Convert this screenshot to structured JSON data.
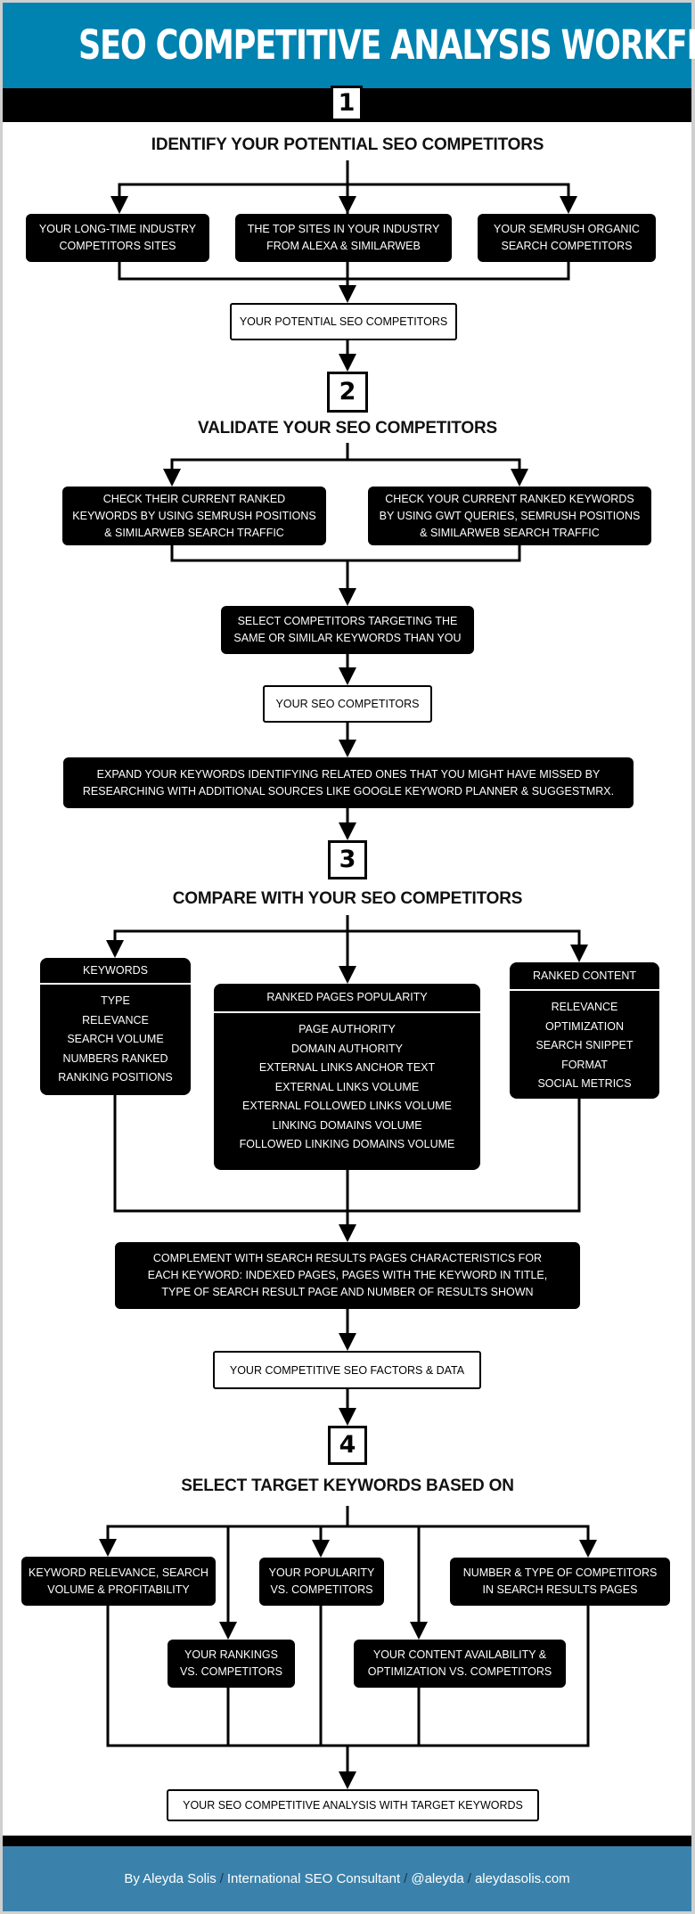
{
  "title": "SEO COMPETITIVE ANALYSIS WORKFLOW",
  "colors": {
    "header_blue": "#0083b0",
    "footer_blue": "#3a82ab",
    "box_black": "#000000",
    "frame_gray": "#cfcfcf"
  },
  "steps": [
    {
      "number": "1",
      "heading": "IDENTIFY YOUR POTENTIAL SEO COMPETITORS",
      "sources": [
        [
          "YOUR LONG-TIME INDUSTRY",
          "COMPETITORS SITES"
        ],
        [
          "THE TOP SITES IN YOUR INDUSTRY",
          "FROM ALEXA & SIMILARWEB"
        ],
        [
          "YOUR SEMRUSH ORGANIC",
          "SEARCH COMPETITORS"
        ]
      ],
      "result": "YOUR POTENTIAL SEO COMPETITORS"
    },
    {
      "number": "2",
      "heading": "VALIDATE YOUR SEO COMPETITORS",
      "checks": [
        [
          "CHECK THEIR CURRENT RANKED",
          "KEYWORDS BY USING SEMRUSH POSITIONS",
          "& SIMILARWEB SEARCH TRAFFIC"
        ],
        [
          "CHECK YOUR CURRENT RANKED KEYWORDS",
          "BY USING GWT QUERIES, SEMRUSH POSITIONS",
          "& SIMILARWEB SEARCH TRAFFIC"
        ]
      ],
      "select": [
        "SELECT COMPETITORS TARGETING THE",
        "SAME OR SIMILAR KEYWORDS THAN YOU"
      ],
      "result": "YOUR SEO COMPETITORS",
      "expand": [
        "EXPAND YOUR KEYWORDS IDENTIFYING RELATED ONES THAT YOU MIGHT HAVE MISSED BY",
        "RESEARCHING WITH ADDITIONAL SOURCES LIKE GOOGLE KEYWORD PLANNER & SUGGESTMRX."
      ]
    },
    {
      "number": "3",
      "heading": "COMPARE WITH YOUR SEO COMPETITORS",
      "cards": [
        {
          "title": "KEYWORDS",
          "items": [
            "TYPE",
            "RELEVANCE",
            "SEARCH VOLUME",
            "NUMBERS RANKED",
            "RANKING POSITIONS"
          ]
        },
        {
          "title": "RANKED PAGES POPULARITY",
          "items": [
            "PAGE AUTHORITY",
            "DOMAIN AUTHORITY",
            "EXTERNAL LINKS ANCHOR TEXT",
            "EXTERNAL LINKS VOLUME",
            "EXTERNAL FOLLOWED LINKS VOLUME",
            "LINKING DOMAINS VOLUME",
            "FOLLOWED LINKING DOMAINS VOLUME"
          ]
        },
        {
          "title": "RANKED CONTENT",
          "items": [
            "RELEVANCE",
            "OPTIMIZATION",
            "SEARCH SNIPPET",
            "FORMAT",
            "SOCIAL METRICS"
          ]
        }
      ],
      "complement": [
        "COMPLEMENT WITH SEARCH RESULTS PAGES CHARACTERISTICS FOR",
        "EACH KEYWORD:  INDEXED PAGES, PAGES WITH THE KEYWORD IN TITLE,",
        "TYPE OF SEARCH RESULT PAGE AND NUMBER OF RESULTS SHOWN"
      ],
      "result": "YOUR COMPETITIVE SEO FACTORS & DATA"
    },
    {
      "number": "4",
      "heading": "SELECT TARGET KEYWORDS BASED ON",
      "criteria": [
        [
          "KEYWORD RELEVANCE, SEARCH",
          "VOLUME & PROFITABILITY"
        ],
        [
          "YOUR RANKINGS",
          "VS. COMPETITORS"
        ],
        [
          "YOUR POPULARITY",
          "VS. COMPETITORS"
        ],
        [
          "YOUR CONTENT AVAILABILITY &",
          "OPTIMIZATION VS. COMPETITORS"
        ],
        [
          "NUMBER & TYPE OF COMPETITORS",
          "IN SEARCH RESULTS PAGES"
        ]
      ],
      "result": "YOUR SEO COMPETITIVE ANALYSIS WITH TARGET KEYWORDS"
    }
  ],
  "footer": {
    "author": "By Aleyda Solis",
    "role": "International SEO Consultant",
    "handle": "@aleyda",
    "site": "aleydasolis.com",
    "separator": "/"
  }
}
